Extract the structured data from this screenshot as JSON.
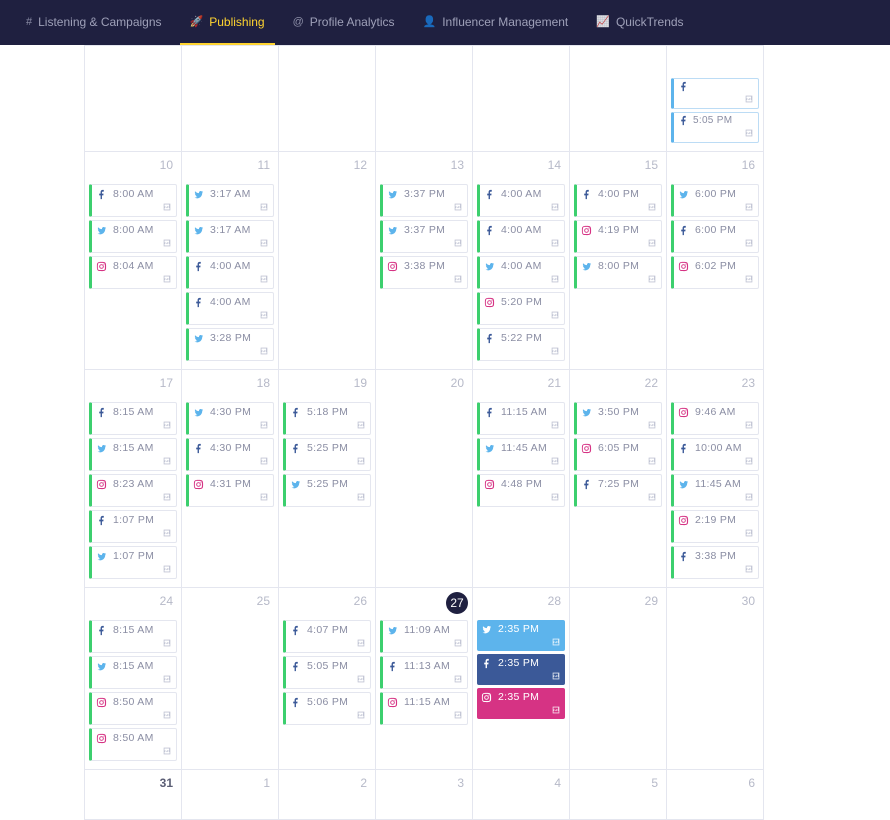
{
  "nav": [
    {
      "icon": "#",
      "label": "Listening & Campaigns"
    },
    {
      "icon": "🚀",
      "label": "Publishing"
    },
    {
      "icon": "@",
      "label": "Profile Analytics"
    },
    {
      "icon": "👤",
      "label": "Influencer Management"
    },
    {
      "icon": "📈",
      "label": "QuickTrends"
    }
  ],
  "nav_active_index": 1,
  "colors": {
    "facebook": "#3b5998",
    "twitter": "#5db4ec",
    "instagram": "#d63384",
    "green": "#3ccf6e"
  },
  "weeks": [
    {
      "days": [
        {
          "num": ""
        },
        {
          "num": ""
        },
        {
          "num": ""
        },
        {
          "num": ""
        },
        {
          "num": ""
        },
        {
          "num": ""
        },
        {
          "num": "",
          "events": [
            {
              "net": "facebook",
              "time": "",
              "style": "blueborder"
            },
            {
              "net": "facebook",
              "time": "5:05 PM",
              "style": "blueborder"
            }
          ]
        }
      ]
    },
    {
      "days": [
        {
          "num": "10",
          "events": [
            {
              "net": "facebook",
              "time": "8:00 AM",
              "left": "green"
            },
            {
              "net": "twitter",
              "time": "8:00 AM",
              "left": "green"
            },
            {
              "net": "instagram",
              "time": "8:04 AM",
              "left": "green"
            }
          ]
        },
        {
          "num": "11",
          "events": [
            {
              "net": "twitter",
              "time": "3:17 AM",
              "left": "green"
            },
            {
              "net": "twitter",
              "time": "3:17 AM",
              "left": "green"
            },
            {
              "net": "facebook",
              "time": "4:00 AM",
              "left": "green"
            },
            {
              "net": "facebook",
              "time": "4:00 AM",
              "left": "green"
            },
            {
              "net": "twitter",
              "time": "3:28 PM",
              "left": "green"
            }
          ]
        },
        {
          "num": "12"
        },
        {
          "num": "13",
          "events": [
            {
              "net": "twitter",
              "time": "3:37 PM",
              "left": "green"
            },
            {
              "net": "twitter",
              "time": "3:37 PM",
              "left": "green"
            },
            {
              "net": "instagram",
              "time": "3:38 PM",
              "left": "green"
            }
          ]
        },
        {
          "num": "14",
          "events": [
            {
              "net": "facebook",
              "time": "4:00 AM",
              "left": "green"
            },
            {
              "net": "facebook",
              "time": "4:00 AM",
              "left": "green"
            },
            {
              "net": "twitter",
              "time": "4:00 AM",
              "left": "green"
            },
            {
              "net": "instagram",
              "time": "5:20 PM",
              "left": "green"
            },
            {
              "net": "facebook",
              "time": "5:22 PM",
              "left": "green"
            }
          ]
        },
        {
          "num": "15",
          "events": [
            {
              "net": "facebook",
              "time": "4:00 PM",
              "left": "green"
            },
            {
              "net": "instagram",
              "time": "4:19 PM",
              "left": "green"
            },
            {
              "net": "twitter",
              "time": "8:00 PM",
              "left": "green"
            }
          ]
        },
        {
          "num": "16",
          "events": [
            {
              "net": "twitter",
              "time": "6:00 PM",
              "left": "green"
            },
            {
              "net": "facebook",
              "time": "6:00 PM",
              "left": "green"
            },
            {
              "net": "instagram",
              "time": "6:02 PM",
              "left": "green"
            }
          ]
        }
      ]
    },
    {
      "days": [
        {
          "num": "17",
          "events": [
            {
              "net": "facebook",
              "time": "8:15 AM",
              "left": "green"
            },
            {
              "net": "twitter",
              "time": "8:15 AM",
              "left": "green"
            },
            {
              "net": "instagram",
              "time": "8:23 AM",
              "left": "green"
            },
            {
              "net": "facebook",
              "time": "1:07 PM",
              "left": "green"
            },
            {
              "net": "twitter",
              "time": "1:07 PM",
              "left": "green"
            }
          ]
        },
        {
          "num": "18",
          "events": [
            {
              "net": "twitter",
              "time": "4:30 PM",
              "left": "green"
            },
            {
              "net": "facebook",
              "time": "4:30 PM",
              "left": "green"
            },
            {
              "net": "instagram",
              "time": "4:31 PM",
              "left": "green"
            }
          ]
        },
        {
          "num": "19",
          "events": [
            {
              "net": "facebook",
              "time": "5:18 PM",
              "left": "green"
            },
            {
              "net": "facebook",
              "time": "5:25 PM",
              "left": "green"
            },
            {
              "net": "twitter",
              "time": "5:25 PM",
              "left": "green"
            }
          ]
        },
        {
          "num": "20"
        },
        {
          "num": "21",
          "events": [
            {
              "net": "facebook",
              "time": "11:15 AM",
              "left": "green"
            },
            {
              "net": "twitter",
              "time": "11:45 AM",
              "left": "green"
            },
            {
              "net": "instagram",
              "time": "4:48 PM",
              "left": "green"
            }
          ]
        },
        {
          "num": "22",
          "events": [
            {
              "net": "twitter",
              "time": "3:50 PM",
              "left": "green"
            },
            {
              "net": "instagram",
              "time": "6:05 PM",
              "left": "green"
            },
            {
              "net": "facebook",
              "time": "7:25 PM",
              "left": "green"
            }
          ]
        },
        {
          "num": "23",
          "events": [
            {
              "net": "instagram",
              "time": "9:46 AM",
              "left": "green"
            },
            {
              "net": "facebook",
              "time": "10:00 AM",
              "left": "green"
            },
            {
              "net": "twitter",
              "time": "11:45 AM",
              "left": "green"
            },
            {
              "net": "instagram",
              "time": "2:19 PM",
              "left": "green"
            },
            {
              "net": "facebook",
              "time": "3:38 PM",
              "left": "green"
            }
          ]
        }
      ]
    },
    {
      "days": [
        {
          "num": "24",
          "events": [
            {
              "net": "facebook",
              "time": "8:15 AM",
              "left": "green"
            },
            {
              "net": "twitter",
              "time": "8:15 AM",
              "left": "green"
            },
            {
              "net": "instagram",
              "time": "8:50 AM",
              "left": "green"
            },
            {
              "net": "instagram",
              "time": "8:50 AM",
              "left": "green"
            }
          ]
        },
        {
          "num": "25"
        },
        {
          "num": "26",
          "events": [
            {
              "net": "facebook",
              "time": "4:07 PM",
              "left": "green"
            },
            {
              "net": "facebook",
              "time": "5:05 PM",
              "left": "green"
            },
            {
              "net": "facebook",
              "time": "5:06 PM",
              "left": "green"
            }
          ]
        },
        {
          "num": "27",
          "today": true,
          "events": [
            {
              "net": "twitter",
              "time": "11:09 AM",
              "left": "green"
            },
            {
              "net": "facebook",
              "time": "11:13 AM",
              "left": "green"
            },
            {
              "net": "instagram",
              "time": "11:15 AM",
              "left": "green"
            }
          ]
        },
        {
          "num": "28",
          "events": [
            {
              "net": "twitter",
              "time": "2:35 PM",
              "fill": "twitter"
            },
            {
              "net": "facebook",
              "time": "2:35 PM",
              "fill": "facebook"
            },
            {
              "net": "instagram",
              "time": "2:35 PM",
              "fill": "instagram"
            }
          ]
        },
        {
          "num": "29"
        },
        {
          "num": "30"
        }
      ]
    },
    {
      "days": [
        {
          "num": "31",
          "strong": true
        },
        {
          "num": "1"
        },
        {
          "num": "2"
        },
        {
          "num": "3"
        },
        {
          "num": "4"
        },
        {
          "num": "5"
        },
        {
          "num": "6"
        }
      ]
    }
  ]
}
